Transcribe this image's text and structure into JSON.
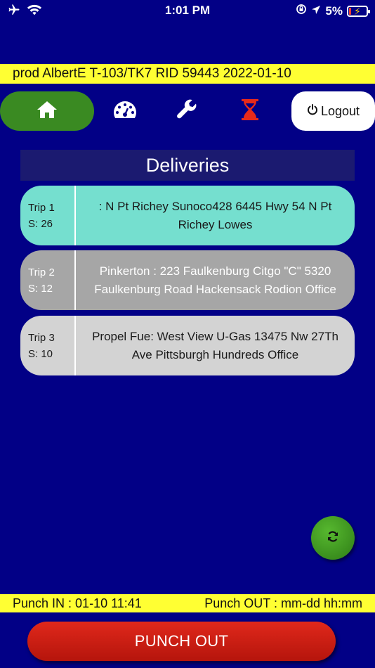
{
  "status_bar": {
    "time": "1:01 PM",
    "battery_percent": "5%",
    "icons": [
      "airplane-icon",
      "wifi-icon",
      "rotation-lock-icon",
      "location-arrow-icon",
      "battery-charging-icon"
    ]
  },
  "info_bar": {
    "text": "prod AlbertE T-103/TK7 RID 59443 2022-01-10"
  },
  "nav": {
    "items": [
      "home-icon",
      "dashboard-gauge-icon",
      "wrench-icon",
      "hourglass-icon"
    ],
    "logout_label": "Logout"
  },
  "deliveries": {
    "title": "Deliveries",
    "trips": [
      {
        "trip": "Trip 1",
        "stops": "S: 26",
        "address": ": N Pt Richey Sunoco428 6445 Hwy 54 N Pt Richey Lowes",
        "bg": "#75dfcf",
        "text_color": "#1a1a1a"
      },
      {
        "trip": "Trip 2",
        "stops": "S: 12",
        "address": "Pinkerton : 223 Faulkenburg Citgo \"C\" 5320 Faulkenburg Road Hackensack Rodion Office",
        "bg": "#a6a6a6",
        "text_color": "#ffffff"
      },
      {
        "trip": "Trip 3",
        "stops": "S: 10",
        "address": "Propel Fue: West View U-Gas 13475 Nw 27Th Ave Pittsburgh Hundreds Office",
        "bg": "#d3d3d3",
        "text_color": "#1a1a1a"
      }
    ]
  },
  "punch": {
    "in_text": "Punch IN : 01-10 11:41",
    "out_text": "Punch OUT : mm-dd hh:mm",
    "button_label": "PUNCH OUT"
  },
  "colors": {
    "background": "#020086",
    "highlight_bar": "#ffff33",
    "home_active": "#3a8a22",
    "punch_button": "#d0201a",
    "hourglass": "#e82a1a"
  }
}
